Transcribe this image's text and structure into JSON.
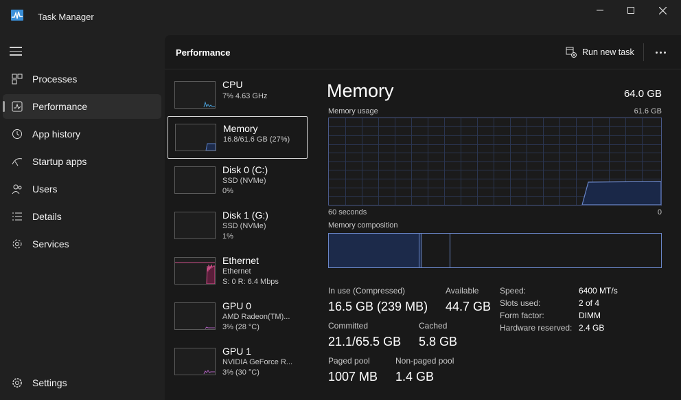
{
  "window": {
    "title": "Task Manager"
  },
  "sidebar": {
    "items": [
      {
        "label": "Processes",
        "icon": "processes-icon"
      },
      {
        "label": "Performance",
        "icon": "performance-icon"
      },
      {
        "label": "App history",
        "icon": "history-icon"
      },
      {
        "label": "Startup apps",
        "icon": "startup-icon"
      },
      {
        "label": "Users",
        "icon": "users-icon"
      },
      {
        "label": "Details",
        "icon": "details-icon"
      },
      {
        "label": "Services",
        "icon": "services-icon"
      }
    ],
    "settings_label": "Settings"
  },
  "header": {
    "title": "Performance",
    "run_new_task": "Run new task"
  },
  "devices": [
    {
      "name": "CPU",
      "line1": "7% 4.63 GHz",
      "line2": ""
    },
    {
      "name": "Memory",
      "line1": "16.8/61.6 GB (27%)",
      "line2": ""
    },
    {
      "name": "Disk 0 (C:)",
      "line1": "SSD (NVMe)",
      "line2": "0%"
    },
    {
      "name": "Disk 1 (G:)",
      "line1": "SSD (NVMe)",
      "line2": "1%"
    },
    {
      "name": "Ethernet",
      "line1": "Ethernet",
      "line2": "S: 0 R: 6.4 Mbps"
    },
    {
      "name": "GPU 0",
      "line1": "AMD Radeon(TM)...",
      "line2": "3% (28 °C)"
    },
    {
      "name": "GPU 1",
      "line1": "NVIDIA GeForce R...",
      "line2": "3% (30 °C)"
    }
  ],
  "memory": {
    "title": "Memory",
    "total": "64.0 GB",
    "usage_label": "Memory usage",
    "usage_max": "61.6 GB",
    "time_span": "60 seconds",
    "time_end": "0",
    "composition_label": "Memory composition",
    "stats": {
      "in_use_label": "In use (Compressed)",
      "in_use_value": "16.5 GB (239 MB)",
      "available_label": "Available",
      "available_value": "44.7 GB",
      "committed_label": "Committed",
      "committed_value": "21.1/65.5 GB",
      "cached_label": "Cached",
      "cached_value": "5.8 GB",
      "paged_label": "Paged pool",
      "paged_value": "1007 MB",
      "nonpaged_label": "Non-paged pool",
      "nonpaged_value": "1.4 GB"
    },
    "specs": {
      "speed_label": "Speed:",
      "speed_value": "6400 MT/s",
      "slots_label": "Slots used:",
      "slots_value": "2 of 4",
      "form_label": "Form factor:",
      "form_value": "DIMM",
      "reserved_label": "Hardware reserved:",
      "reserved_value": "2.4 GB"
    }
  },
  "colors": {
    "memory_accent": "#6a86c8",
    "ethernet_accent": "#d0508a",
    "gpu_accent": "#b060c0",
    "cpu_accent": "#4aa0d8"
  }
}
